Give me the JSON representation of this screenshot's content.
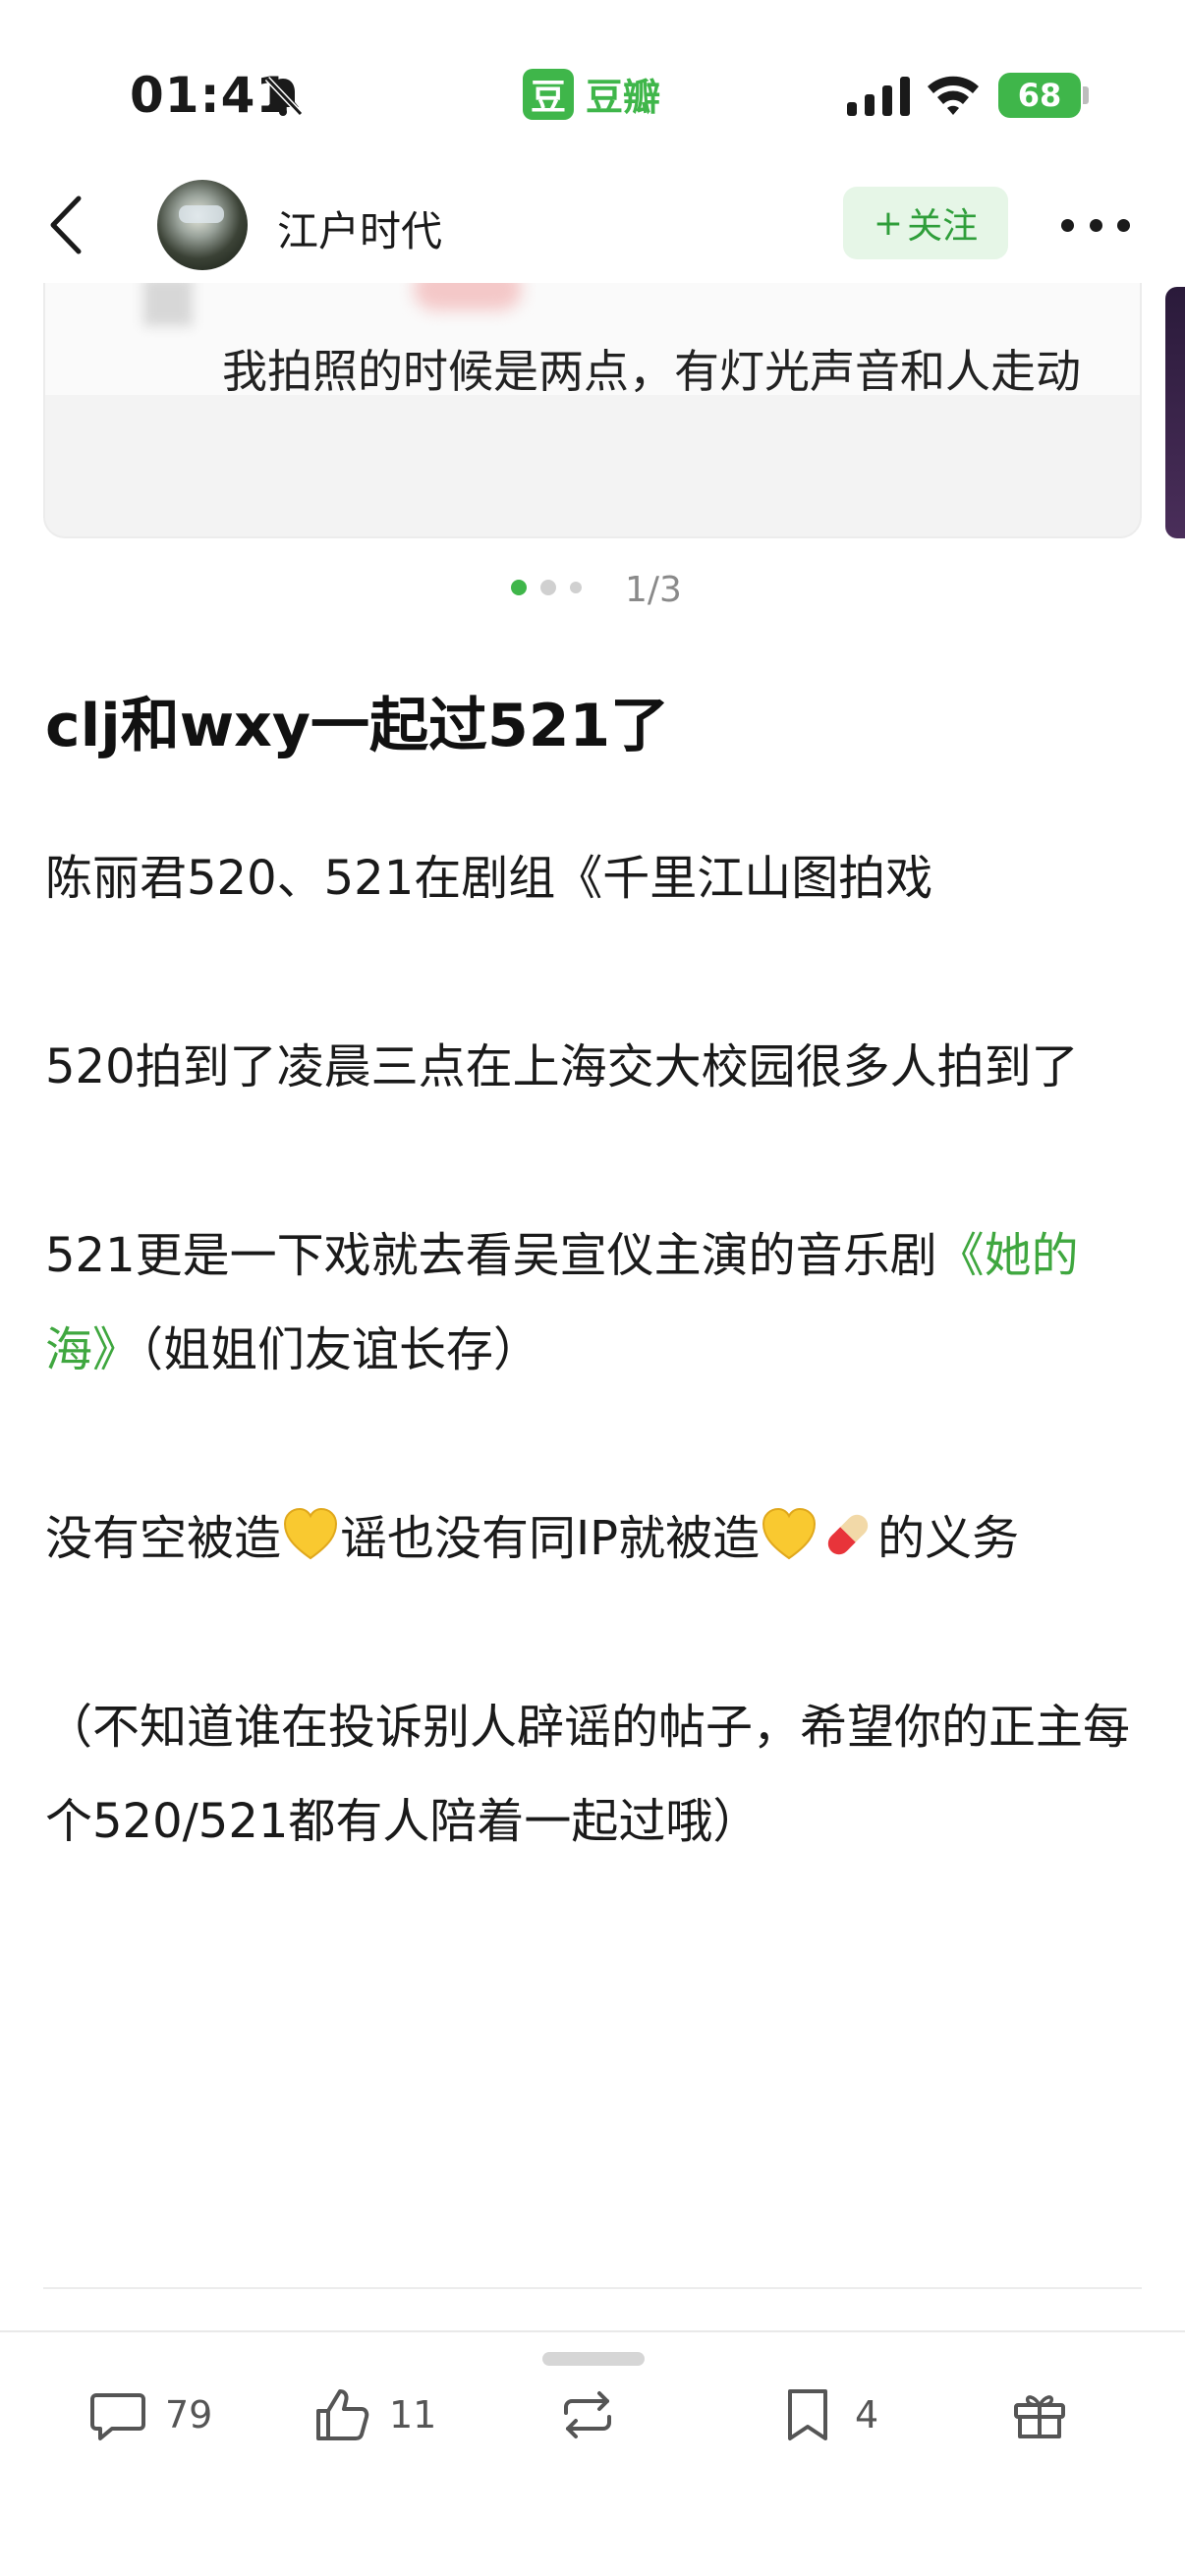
{
  "status_bar": {
    "time": "01:41",
    "app_name": "豆瓣",
    "app_logo_char": "豆",
    "battery": "68",
    "icons": [
      "bell-off-icon",
      "signal-icon",
      "wifi-icon",
      "battery-icon"
    ]
  },
  "nav": {
    "user_name": "江户时代",
    "follow_label": "关注",
    "follow_plus": "+",
    "icons": [
      "back-arrow-icon",
      "more-icon"
    ]
  },
  "carousel": {
    "visible_text": "我拍照的时候是两点，有灯光声音和人走动",
    "page_indicator": "1/3",
    "current_page": 1,
    "total_pages": 3
  },
  "post": {
    "title": "clj和wxy一起过521了",
    "p1": "陈丽君520、521在剧组《千里江山图拍戏",
    "p2": "520拍到了凌晨三点在上海交大校园很多人拍到了",
    "p3_before": "521更是一下戏就去看吴宣仪主演的音乐剧",
    "p3_link": "《她的海》",
    "p3_after": "（姐姐们友谊长存）",
    "p4_a": "没有空被造",
    "p4_b": "谣也没有同IP就被造",
    "p4_c": "的义务",
    "p5": "（不知道谁在投诉别人辟谣的帖子，希望你的正主每个520/521都有人陪着一起过哦）",
    "emojis": [
      "yellow-heart-emoji",
      "pill-emoji"
    ]
  },
  "bottom_bar": {
    "comments": "79",
    "likes": "11",
    "collects": "4",
    "icons": [
      "comment-icon",
      "like-icon",
      "repost-icon",
      "collect-icon",
      "gift-icon"
    ]
  },
  "colors": {
    "brand_green": "#3fb64a",
    "link_green": "#3fa73f",
    "follow_bg": "#e6f6e7"
  }
}
